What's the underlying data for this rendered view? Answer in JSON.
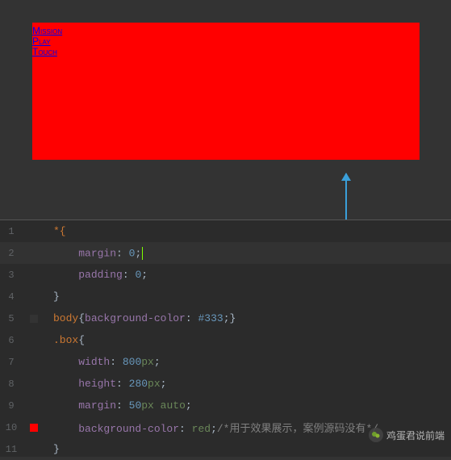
{
  "preview": {
    "links": [
      "Mission",
      "Play",
      "Touch"
    ]
  },
  "editor": {
    "lines": [
      {
        "n": 1,
        "marker": "",
        "tokens": [
          {
            "t": "*{",
            "c": "sel"
          }
        ]
      },
      {
        "n": 2,
        "marker": "",
        "active": true,
        "tokens": [
          {
            "t": "    ",
            "c": ""
          },
          {
            "t": "margin",
            "c": "prop"
          },
          {
            "t": ": ",
            "c": "punc"
          },
          {
            "t": "0",
            "c": "num"
          },
          {
            "t": ";",
            "c": "punc"
          },
          {
            "t": "|cursor|",
            "c": "cursor"
          }
        ]
      },
      {
        "n": 3,
        "marker": "",
        "tokens": [
          {
            "t": "    ",
            "c": ""
          },
          {
            "t": "padding",
            "c": "prop"
          },
          {
            "t": ": ",
            "c": "punc"
          },
          {
            "t": "0",
            "c": "num"
          },
          {
            "t": ";",
            "c": "punc"
          }
        ]
      },
      {
        "n": 4,
        "marker": "",
        "tokens": [
          {
            "t": "}",
            "c": "punc"
          }
        ]
      },
      {
        "n": 5,
        "marker": "#333",
        "tokens": [
          {
            "t": "body",
            "c": "sel"
          },
          {
            "t": "{",
            "c": "punc"
          },
          {
            "t": "background-color",
            "c": "prop"
          },
          {
            "t": ": ",
            "c": "punc"
          },
          {
            "t": "#333",
            "c": "num"
          },
          {
            "t": ";}",
            "c": "punc"
          }
        ]
      },
      {
        "n": 6,
        "marker": "",
        "tokens": [
          {
            "t": ".box",
            "c": "sel"
          },
          {
            "t": "{",
            "c": "punc"
          }
        ]
      },
      {
        "n": 7,
        "marker": "",
        "tokens": [
          {
            "t": "    ",
            "c": ""
          },
          {
            "t": "width",
            "c": "prop"
          },
          {
            "t": ": ",
            "c": "punc"
          },
          {
            "t": "800",
            "c": "num"
          },
          {
            "t": "px",
            "c": "unit"
          },
          {
            "t": ";",
            "c": "punc"
          }
        ]
      },
      {
        "n": 8,
        "marker": "",
        "tokens": [
          {
            "t": "    ",
            "c": ""
          },
          {
            "t": "height",
            "c": "prop"
          },
          {
            "t": ": ",
            "c": "punc"
          },
          {
            "t": "280",
            "c": "num"
          },
          {
            "t": "px",
            "c": "unit"
          },
          {
            "t": ";",
            "c": "punc"
          }
        ]
      },
      {
        "n": 9,
        "marker": "",
        "tokens": [
          {
            "t": "    ",
            "c": ""
          },
          {
            "t": "margin",
            "c": "prop"
          },
          {
            "t": ": ",
            "c": "punc"
          },
          {
            "t": "50",
            "c": "num"
          },
          {
            "t": "px",
            "c": "unit"
          },
          {
            "t": " ",
            "c": ""
          },
          {
            "t": "auto",
            "c": "val"
          },
          {
            "t": ";",
            "c": "punc"
          }
        ]
      },
      {
        "n": 10,
        "marker": "red",
        "tokens": [
          {
            "t": "    ",
            "c": ""
          },
          {
            "t": "background-color",
            "c": "prop"
          },
          {
            "t": ": ",
            "c": "punc"
          },
          {
            "t": "red",
            "c": "val"
          },
          {
            "t": ";",
            "c": "punc"
          },
          {
            "t": "/*用于效果展示，案例源码没有*/",
            "c": "comment"
          }
        ]
      },
      {
        "n": 11,
        "marker": "",
        "tokens": [
          {
            "t": "}",
            "c": "punc"
          }
        ]
      }
    ]
  },
  "watermark": {
    "text": "鸡蛋君说前端"
  }
}
